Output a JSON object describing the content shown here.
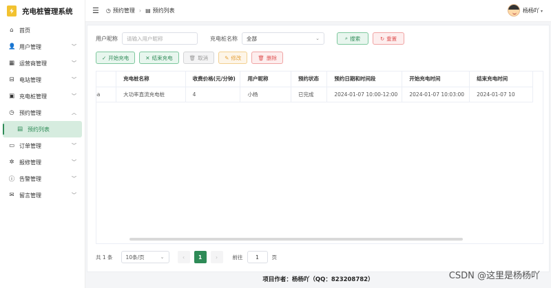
{
  "brand": {
    "title": "充电桩管理系统"
  },
  "sidebar": {
    "items": [
      {
        "label": "首页",
        "icon": "home-icon",
        "glyph": "⌂",
        "expandable": false
      },
      {
        "label": "用户管理",
        "icon": "user-icon",
        "glyph": "👤",
        "expandable": true
      },
      {
        "label": "运营商管理",
        "icon": "building-icon",
        "glyph": "▦",
        "expandable": true
      },
      {
        "label": "电站管理",
        "icon": "station-icon",
        "glyph": "⊟",
        "expandable": true
      },
      {
        "label": "充电桩管理",
        "icon": "pile-icon",
        "glyph": "▣",
        "expandable": true
      },
      {
        "label": "预约管理",
        "icon": "alarm-clock-icon",
        "glyph": "◷",
        "expandable": true,
        "expanded": true
      },
      {
        "label": "预约列表",
        "icon": "list-icon",
        "glyph": "▤",
        "active": true
      },
      {
        "label": "订单管理",
        "icon": "order-icon",
        "glyph": "▭",
        "expandable": true
      },
      {
        "label": "报修管理",
        "icon": "gear-icon",
        "glyph": "✲",
        "expandable": true
      },
      {
        "label": "告警管理",
        "icon": "alert-icon",
        "glyph": "ⓘ",
        "expandable": true
      },
      {
        "label": "留言管理",
        "icon": "message-icon",
        "glyph": "✉",
        "expandable": true
      }
    ]
  },
  "header": {
    "breadcrumb": [
      {
        "label": "预约管理",
        "glyph": "◷"
      },
      {
        "label": "预约列表",
        "glyph": "▤"
      }
    ],
    "username": "杨杨吖"
  },
  "search": {
    "username_label": "用户昵称",
    "username_placeholder": "请输入用户昵称",
    "pile_label": "充电桩名称",
    "pile_value": "全部",
    "search_btn": "搜索",
    "reset_btn": "重置"
  },
  "actions": {
    "start": "开始充电",
    "end": "结束充电",
    "cancel": "取消",
    "edit": "修改",
    "delete": "删除"
  },
  "table": {
    "columns": [
      "",
      "充电桩名称",
      "收费价格(元/分钟)",
      "用户昵称",
      "预约状态",
      "预约日期和时间段",
      "开始充电时间",
      "结束充电时间"
    ],
    "rows": [
      [
        "Sa",
        "大功率直流充电桩",
        "4",
        "小杨",
        "已完成",
        "2024-01-07 10:00-12:00",
        "2024-01-07 10:03:00",
        "2024-01-07 10"
      ]
    ]
  },
  "pagination": {
    "total": "共 1 条",
    "page_size": "10条/页",
    "current": "1",
    "goto_label": "前往",
    "goto_value": "1",
    "page_unit": "页"
  },
  "footer": {
    "text": "项目作者：杨杨吖（QQ：823208782）"
  },
  "watermark": "CSDN @这里是杨杨吖",
  "colors": {
    "accent": "#2e8b57",
    "danger": "#e05555",
    "warning": "#e6a23c"
  }
}
